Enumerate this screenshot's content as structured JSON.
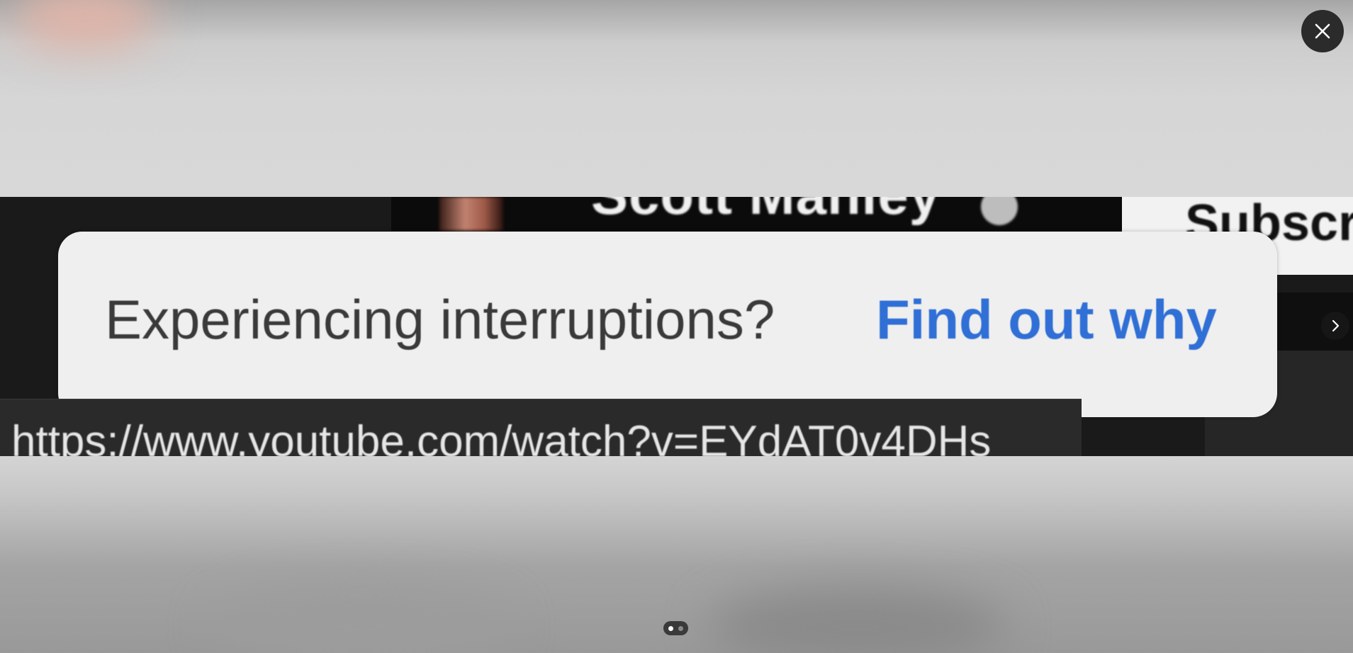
{
  "viewer": {
    "close_icon": "close-icon",
    "next_icon": "chevron-right-icon",
    "pager": {
      "count": 2,
      "active_index": 0
    }
  },
  "screenshot": {
    "channel_name": "Scott Manley",
    "subscribe_label": "Subscr",
    "notice": {
      "text": "Experiencing interruptions?",
      "link": "Find out why",
      "link_color": "#2f6fd6"
    },
    "url": "https://www.youtube.com/watch?v=EYdAT0v4DHs"
  }
}
